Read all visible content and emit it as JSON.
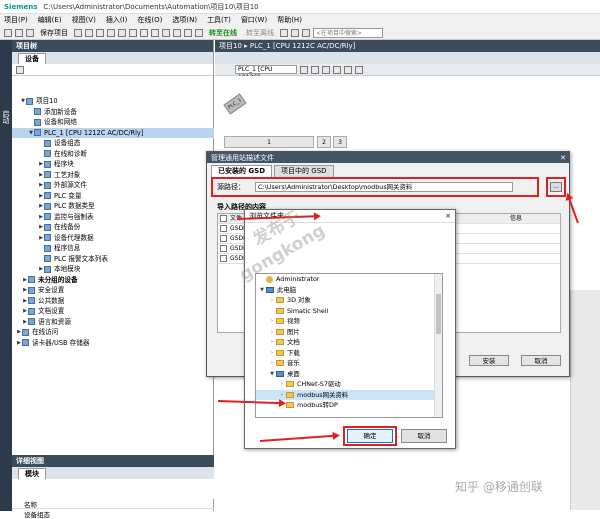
{
  "window": {
    "app": "Siemens",
    "path": "C:\\Users\\Administrator\\Documents\\Automation\\项目10\\项目10"
  },
  "menu": [
    "项目(P)",
    "编辑(E)",
    "视图(V)",
    "插入(I)",
    "在线(O)",
    "选项(N)",
    "工具(T)",
    "窗口(W)",
    "帮助(H)"
  ],
  "toolbar": {
    "save_label": "保存项目",
    "go_online": "转至在线",
    "go_offline": "转至离线",
    "search_placeholder": "<在项目中搜索>"
  },
  "left_strip": {
    "label": "启动"
  },
  "project_tree": {
    "title": "项目树",
    "tab": "设备",
    "items": [
      {
        "label": "项目10",
        "level": 0
      },
      {
        "label": "添加新设备",
        "level": 1
      },
      {
        "label": "设备和网络",
        "level": 1
      },
      {
        "label": "PLC_1 [CPU 1212C AC/DC/Rly]",
        "level": 1
      },
      {
        "label": "设备组态",
        "level": 2
      },
      {
        "label": "在线和诊断",
        "level": 2
      },
      {
        "label": "程序块",
        "level": 2
      },
      {
        "label": "工艺对象",
        "level": 2
      },
      {
        "label": "外部源文件",
        "level": 2
      },
      {
        "label": "PLC 变量",
        "level": 2
      },
      {
        "label": "PLC 数据类型",
        "level": 2
      },
      {
        "label": "监控与强制表",
        "level": 2
      },
      {
        "label": "在线备份",
        "level": 2
      },
      {
        "label": "设备代理数据",
        "level": 2
      },
      {
        "label": "程序信息",
        "level": 2
      },
      {
        "label": "PLC 报警文本列表",
        "level": 2
      },
      {
        "label": "本地模块",
        "level": 2
      },
      {
        "label": "未分组的设备",
        "level": 0
      },
      {
        "label": "安全设置",
        "level": 0
      },
      {
        "label": "公共数据",
        "level": 0
      },
      {
        "label": "文档设置",
        "level": 0
      },
      {
        "label": "语言和资源",
        "level": 0
      },
      {
        "label": "在线访问",
        "level": 0
      },
      {
        "label": "读卡器/USB 存储器",
        "level": 0
      }
    ]
  },
  "detail_view": {
    "title": "详细视图",
    "tab": "模块",
    "col_name": "名称",
    "row1": "设备组态"
  },
  "editor": {
    "breadcrumb": "项目10 ▸ PLC_1 [CPU 1212C AC/DC/Rly]",
    "device_dropdown": "PLC_1 [CPU 1212C]",
    "rack_label": "PLC_1",
    "rack_slots": [
      "1",
      "2",
      "3"
    ]
  },
  "gsd_dialog": {
    "title": "管理通用站描述文件",
    "tab_installed": "已安装的 GSD",
    "tab_project": "项目中的 GSD",
    "source_label": "源路径：",
    "source_path": "C:\\Users\\Administrator\\Desktop\\modbus网关资料",
    "browse_label": "...",
    "import_title": "导入路径的内容",
    "col_file": "文件",
    "col_info": "信息",
    "rows": [
      "GSDM",
      "GSDM",
      "GSDM",
      "GSDM"
    ],
    "btn_install": "安装",
    "btn_cancel": "取消"
  },
  "browse_dialog": {
    "title": "浏览文件夹",
    "close": "×",
    "items": [
      {
        "label": "Administrator",
        "icon": "user",
        "level": 0
      },
      {
        "label": "此电脑",
        "icon": "pc",
        "level": 0,
        "expanded": true
      },
      {
        "label": "3D 对象",
        "icon": "folder",
        "level": 1
      },
      {
        "label": "Simatic Shell",
        "icon": "folder",
        "level": 1
      },
      {
        "label": "视频",
        "icon": "folder",
        "level": 1
      },
      {
        "label": "图片",
        "icon": "folder",
        "level": 1
      },
      {
        "label": "文档",
        "icon": "folder",
        "level": 1
      },
      {
        "label": "下载",
        "icon": "folder",
        "level": 1
      },
      {
        "label": "音乐",
        "icon": "folder",
        "level": 1
      },
      {
        "label": "桌面",
        "icon": "folder",
        "level": 1,
        "expanded": true
      },
      {
        "label": "CHNet-S7驱动",
        "icon": "folder",
        "level": 2
      },
      {
        "label": "modbus网关资料",
        "icon": "folder",
        "level": 2,
        "selected": true
      },
      {
        "label": "modbus转DP",
        "icon": "folder",
        "level": 2
      }
    ],
    "btn_ok": "确定",
    "btn_cancel": "取消"
  },
  "watermark": {
    "text1": "发布于",
    "text2": "gongkong",
    "zhihu": "知乎 @移通创联"
  }
}
